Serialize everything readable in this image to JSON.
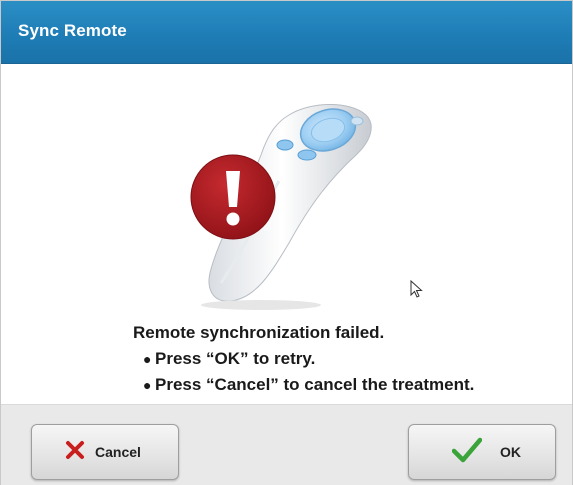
{
  "dialog": {
    "title": "Sync Remote"
  },
  "illustration": {
    "subject": "remote-control",
    "alert_icon": "exclamation-alert-icon",
    "alert_color": "#a8181e",
    "remote_button_color": "#8fc6ef"
  },
  "message": {
    "heading": "Remote synchronization failed.",
    "bullets": [
      "Press “OK” to retry.",
      "Press “Cancel” to cancel the treatment."
    ]
  },
  "buttons": {
    "cancel": {
      "label": "Cancel",
      "icon": "x-icon",
      "icon_color": "#c81e1e"
    },
    "ok": {
      "label": "OK",
      "icon": "checkmark-icon",
      "icon_color": "#3aa33a"
    }
  },
  "colors": {
    "title_bar": "#1f7db6",
    "button_bar": "#e9e9e9"
  }
}
